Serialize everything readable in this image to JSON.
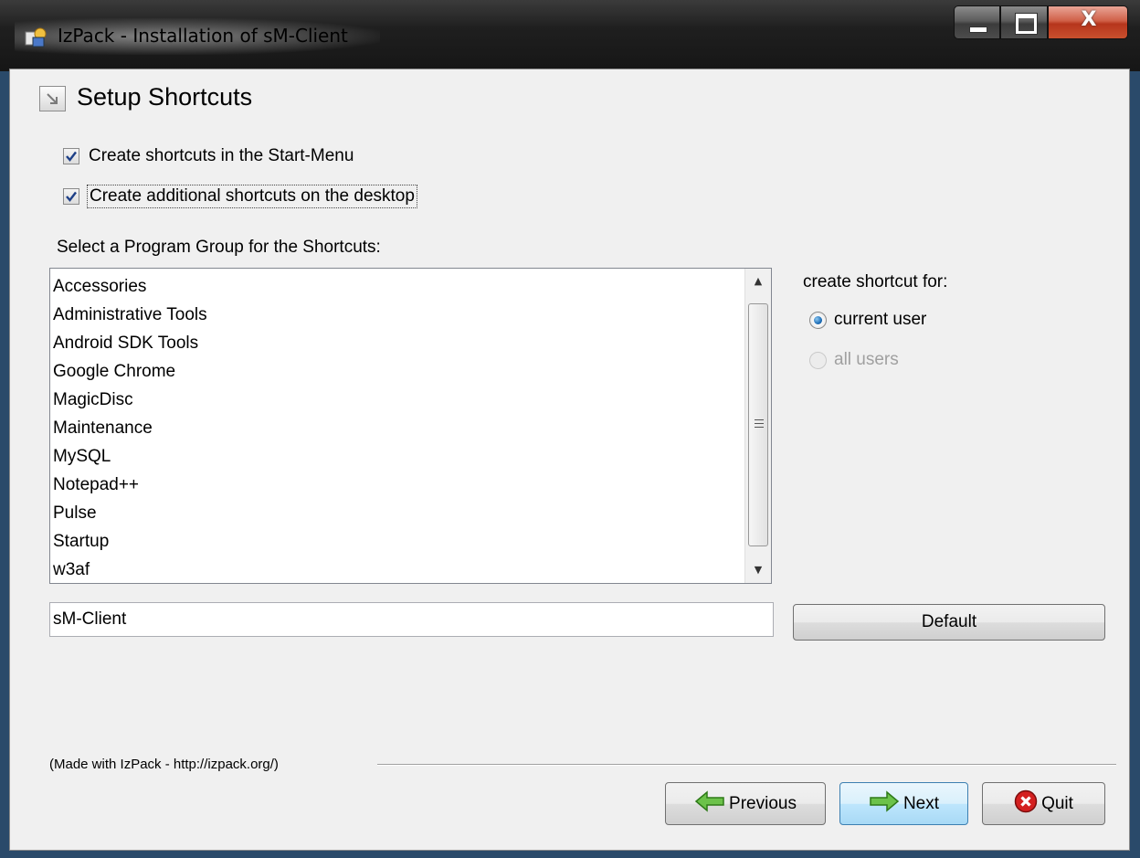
{
  "window": {
    "title": "IzPack - Installation of sM-Client",
    "close_glyph": "X"
  },
  "page": {
    "title": "Setup Shortcuts"
  },
  "options": {
    "start_menu": {
      "label": "Create shortcuts in the Start-Menu",
      "checked": true
    },
    "desktop": {
      "label": "Create additional shortcuts on the desktop",
      "checked": true
    }
  },
  "program_group": {
    "label": "Select a Program Group for the Shortcuts:",
    "items": [
      "Accessories",
      "Administrative Tools",
      "Android SDK Tools",
      "Google Chrome",
      "MagicDisc",
      "Maintenance",
      "MySQL",
      "Notepad++",
      "Pulse",
      "Startup",
      "w3af"
    ],
    "name_value": "sM-Client",
    "default_button": "Default"
  },
  "shortcut_for": {
    "label": "create shortcut for:",
    "options": [
      {
        "label": "current user",
        "selected": true,
        "enabled": true
      },
      {
        "label": "all users",
        "selected": false,
        "enabled": false
      }
    ]
  },
  "footer": {
    "credit": "(Made with IzPack - http://izpack.org/)",
    "previous": "Previous",
    "next": "Next",
    "quit": "Quit"
  },
  "colors": {
    "arrow_green": "#5bb53a",
    "quit_red": "#d42020",
    "radio_blue": "#1e6fb8"
  }
}
